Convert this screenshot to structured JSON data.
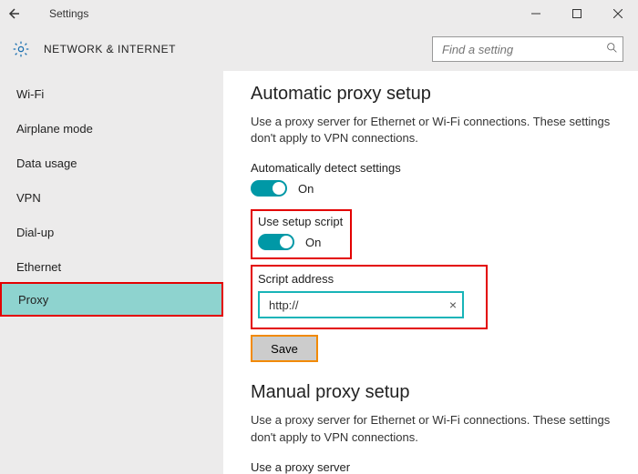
{
  "window": {
    "title": "Settings"
  },
  "header": {
    "section": "NETWORK & INTERNET",
    "search_placeholder": "Find a setting"
  },
  "sidebar": {
    "items": [
      {
        "label": "Wi-Fi"
      },
      {
        "label": "Airplane mode"
      },
      {
        "label": "Data usage"
      },
      {
        "label": "VPN"
      },
      {
        "label": "Dial-up"
      },
      {
        "label": "Ethernet"
      },
      {
        "label": "Proxy"
      }
    ],
    "selected_index": 6
  },
  "content": {
    "auto_title": "Automatic proxy setup",
    "auto_desc": "Use a proxy server for Ethernet or Wi-Fi connections. These settings don't apply to VPN connections.",
    "auto_detect_label": "Automatically detect settings",
    "auto_detect_state": "On",
    "use_script_label": "Use setup script",
    "use_script_state": "On",
    "script_addr_label": "Script address",
    "script_addr_value": "http://",
    "save_label": "Save",
    "manual_title": "Manual proxy setup",
    "manual_desc": "Use a proxy server for Ethernet or Wi-Fi connections. These settings don't apply to VPN connections.",
    "use_proxy_label": "Use a proxy server"
  }
}
